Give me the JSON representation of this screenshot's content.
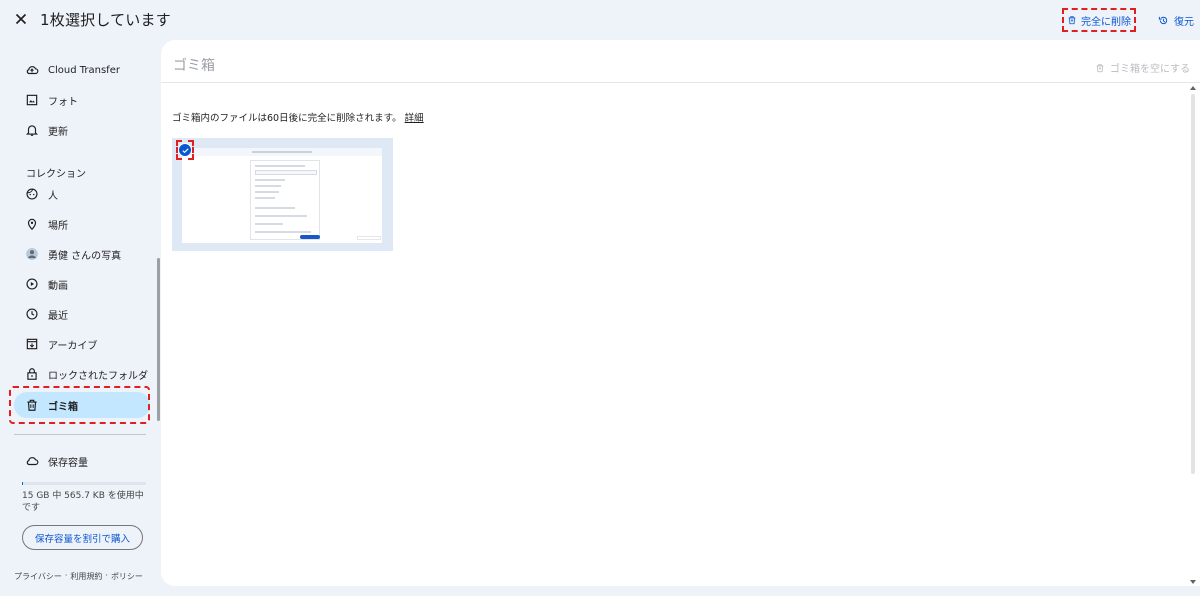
{
  "topbar": {
    "selection_title": "1枚選択しています",
    "permanent_delete_label": "完全に削除",
    "restore_label": "復元"
  },
  "sidebar": {
    "items_top": [
      {
        "label": "Cloud Transfer",
        "icon": "cloud-upload-icon"
      },
      {
        "label": "フォト",
        "icon": "photo-icon"
      },
      {
        "label": "更新",
        "icon": "bell-icon"
      }
    ],
    "collections_title": "コレクション",
    "collections": [
      {
        "label": "人",
        "icon": "face-icon"
      },
      {
        "label": "場所",
        "icon": "location-pin-icon"
      },
      {
        "label": "勇健 さんの写真",
        "icon": "shared-avatar-icon"
      },
      {
        "label": "動画",
        "icon": "play-circle-icon"
      },
      {
        "label": "最近",
        "icon": "clock-icon"
      },
      {
        "label": "アーカイブ",
        "icon": "archive-icon"
      },
      {
        "label": "ロックされたフォルダ",
        "icon": "lock-icon"
      },
      {
        "label": "ゴミ箱",
        "icon": "trash-icon",
        "active": true
      }
    ],
    "storage_label": "保存容量",
    "storage_usage": "15 GB 中 565.7 KB を使用中です",
    "storage_used_fraction": 0.01,
    "buy_storage_label": "保存容量を割引で購入",
    "footer": {
      "privacy": "プライバシー",
      "terms": "利用規約",
      "policy": "ポリシー",
      "separator": "·"
    }
  },
  "main": {
    "title": "ゴミ箱",
    "empty_trash_label": "ゴミ箱を空にする",
    "notice": "ゴミ箱内のファイルは60日後に完全に削除されます。",
    "details_link": "詳細"
  },
  "colors": {
    "accent": "#0b57d0",
    "active_nav_bg": "#c2e7ff",
    "highlight_dash": "#e02020",
    "page_bg": "#eef2f9"
  }
}
